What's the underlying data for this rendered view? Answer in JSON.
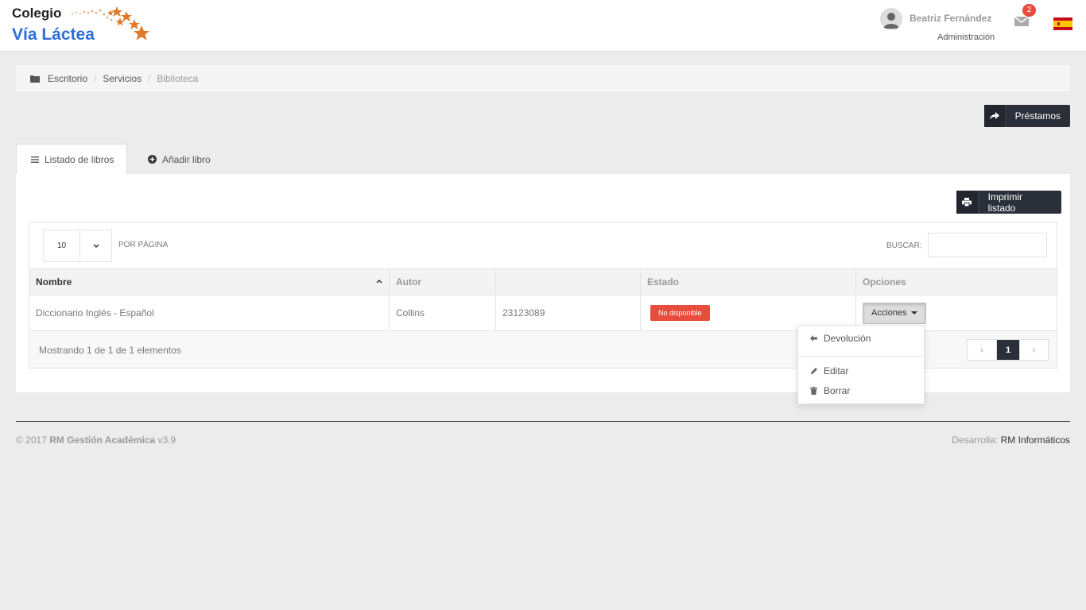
{
  "header": {
    "logo": {
      "line1": "Colegio",
      "line2": "Vía Láctea"
    },
    "user": {
      "name": "Beatriz Fernández",
      "role": "Administración"
    },
    "mail_count": "2",
    "flag_icon": "spain-flag-icon"
  },
  "breadcrumb": {
    "items": [
      "Escritorio",
      "Servicios",
      "Biblioteca"
    ],
    "separator": "/"
  },
  "actions": {
    "prestamos_label": "Préstamos",
    "print_label": "Imprimir listado"
  },
  "tabs": [
    {
      "label": "Listado de libros",
      "icon": "list-icon",
      "active": true
    },
    {
      "label": "Añadir libro",
      "icon": "plus-circle-icon",
      "active": false
    }
  ],
  "table": {
    "per_page": "10",
    "per_page_label": "POR PÁGINA",
    "search_label": "BUSCAR:",
    "search_value": "",
    "columns": [
      "Nombre",
      "Autor",
      "",
      "Estado",
      "Opciones"
    ],
    "rows": [
      {
        "nombre": "Diccionario Inglés - Español",
        "autor": "Collins",
        "codigo": "23123089",
        "estado": "No disponible",
        "opciones": "Acciones"
      }
    ],
    "summary": "Mostrando 1 de 1 de 1 elementos",
    "pagination": {
      "prev": "‹",
      "current": "1",
      "next": "›"
    }
  },
  "dropdown": {
    "items": [
      {
        "label": "Devolución",
        "icon": "arrow-left-icon"
      },
      {
        "label": "Editar",
        "icon": "pencil-icon"
      },
      {
        "label": "Borrar",
        "icon": "trash-icon"
      }
    ]
  },
  "footer": {
    "copyright": "© 2017",
    "product": "RM Gestión Académica",
    "version": "v3.9",
    "dev_label": "Desarrolla:",
    "dev_name": "RM Informáticos"
  },
  "colors": {
    "dark": "#2b2f3a",
    "danger": "#e74c3c",
    "brand_blue": "#2f6ed6",
    "star_orange": "#e07a2a"
  }
}
